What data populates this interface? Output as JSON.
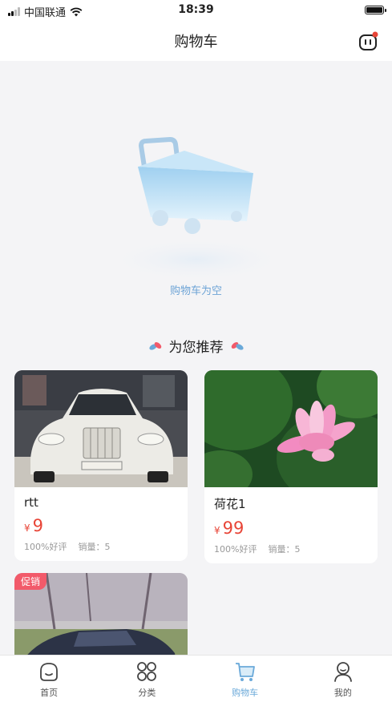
{
  "status_bar": {
    "carrier": "中国联通",
    "time": "18:39"
  },
  "nav": {
    "title": "购物车",
    "message_icon": "message-robot-icon",
    "has_notification": true
  },
  "empty_cart": {
    "text": "购物车为空",
    "illustration": "empty-cart-illustration"
  },
  "recommend": {
    "title": "为您推荐",
    "products": [
      {
        "name": "rtt",
        "currency": "¥",
        "price": "9",
        "rating": "100%好评",
        "sales": "销量：5",
        "image": "white-luxury-car"
      },
      {
        "name": "荷花1",
        "currency": "¥",
        "price": "99",
        "rating": "100%好评",
        "sales": "销量：5",
        "image": "pink-lotus-flower"
      },
      {
        "badge": "促销",
        "image": "dark-sports-car"
      }
    ]
  },
  "tabs": [
    {
      "label": "首页",
      "icon": "home-icon",
      "active": false
    },
    {
      "label": "分类",
      "icon": "category-icon",
      "active": false
    },
    {
      "label": "购物车",
      "icon": "cart-icon",
      "active": true
    },
    {
      "label": "我的",
      "icon": "profile-icon",
      "active": false
    }
  ],
  "colors": {
    "accent": "#6aa9d9",
    "price": "#e84537",
    "promo": "#f25a6a",
    "background": "#f4f4f6"
  }
}
